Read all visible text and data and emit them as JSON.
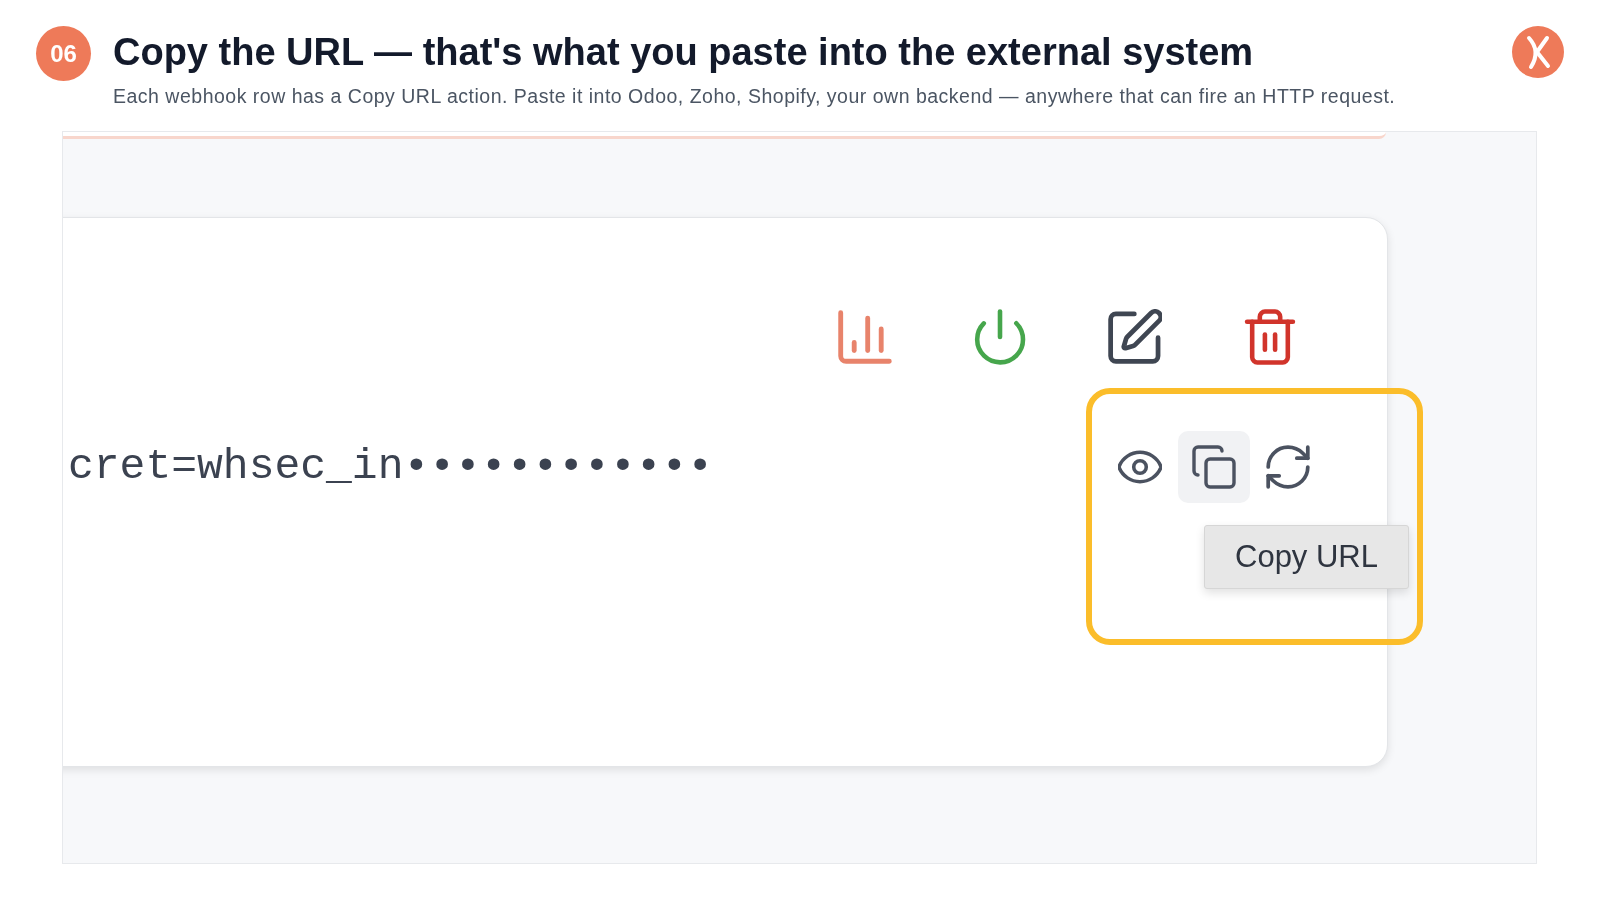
{
  "step": {
    "number": "06",
    "title": "Copy the URL — that's what you paste into the external system",
    "description": "Each webhook row has a Copy URL action. Paste it into Odoo, Zoho, Shopify, your own backend — anywhere that can fire an HTTP request."
  },
  "webhook": {
    "enabled": true,
    "actions": [
      {
        "kind": "stats"
      },
      {
        "kind": "toggle"
      },
      {
        "kind": "edit"
      },
      {
        "kind": "delete"
      }
    ],
    "secret": {
      "value": "cret=whsec_in••••••••••••",
      "actions": [
        {
          "kind": "reveal",
          "hovered": false
        },
        {
          "kind": "copy",
          "hovered": true
        },
        {
          "kind": "regenerate",
          "hovered": false
        }
      ]
    },
    "tooltip": "Copy URL"
  }
}
